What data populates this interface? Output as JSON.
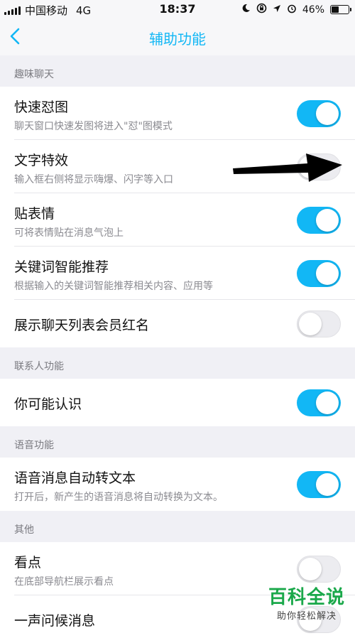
{
  "status_bar": {
    "carrier": "中国移动",
    "network": "4G",
    "time": "18:37",
    "battery_percent": "46%",
    "battery_level": 0.46
  },
  "nav": {
    "title": "辅助功能",
    "back_icon": "chevron-left-icon"
  },
  "colors": {
    "accent": "#12b7f5",
    "toggle_off": "#ececf0",
    "section_bg": "#f0f0f5"
  },
  "sections": [
    {
      "header": "趣味聊天",
      "rows": [
        {
          "title": "快速怼图",
          "subtitle": "聊天窗口快速发图将进入\"怼\"图模式",
          "on": true
        },
        {
          "title": "文字特效",
          "subtitle": "输入框右侧将显示嗨爆、闪字等入口",
          "on": false
        },
        {
          "title": "贴表情",
          "subtitle": "可将表情贴在消息气泡上",
          "on": true
        },
        {
          "title": "关键词智能推荐",
          "subtitle": "根据输入的关键词智能推荐相关内容、应用等",
          "on": true
        },
        {
          "title": "展示聊天列表会员红名",
          "on": false
        }
      ]
    },
    {
      "header": "联系人功能",
      "rows": [
        {
          "title": "你可能认识",
          "on": true
        }
      ]
    },
    {
      "header": "语音功能",
      "rows": [
        {
          "title": "语音消息自动转文本",
          "subtitle": "打开后，新产生的语音消息将自动转换为文本。",
          "on": true
        }
      ]
    },
    {
      "header": "其他",
      "rows": [
        {
          "title": "看点",
          "subtitle": "在底部导航栏展示看点",
          "on": false
        },
        {
          "title": "一声问候消息",
          "on": false
        }
      ]
    }
  ],
  "watermark": {
    "main": "百科全说",
    "sub": "助你轻松解决"
  }
}
